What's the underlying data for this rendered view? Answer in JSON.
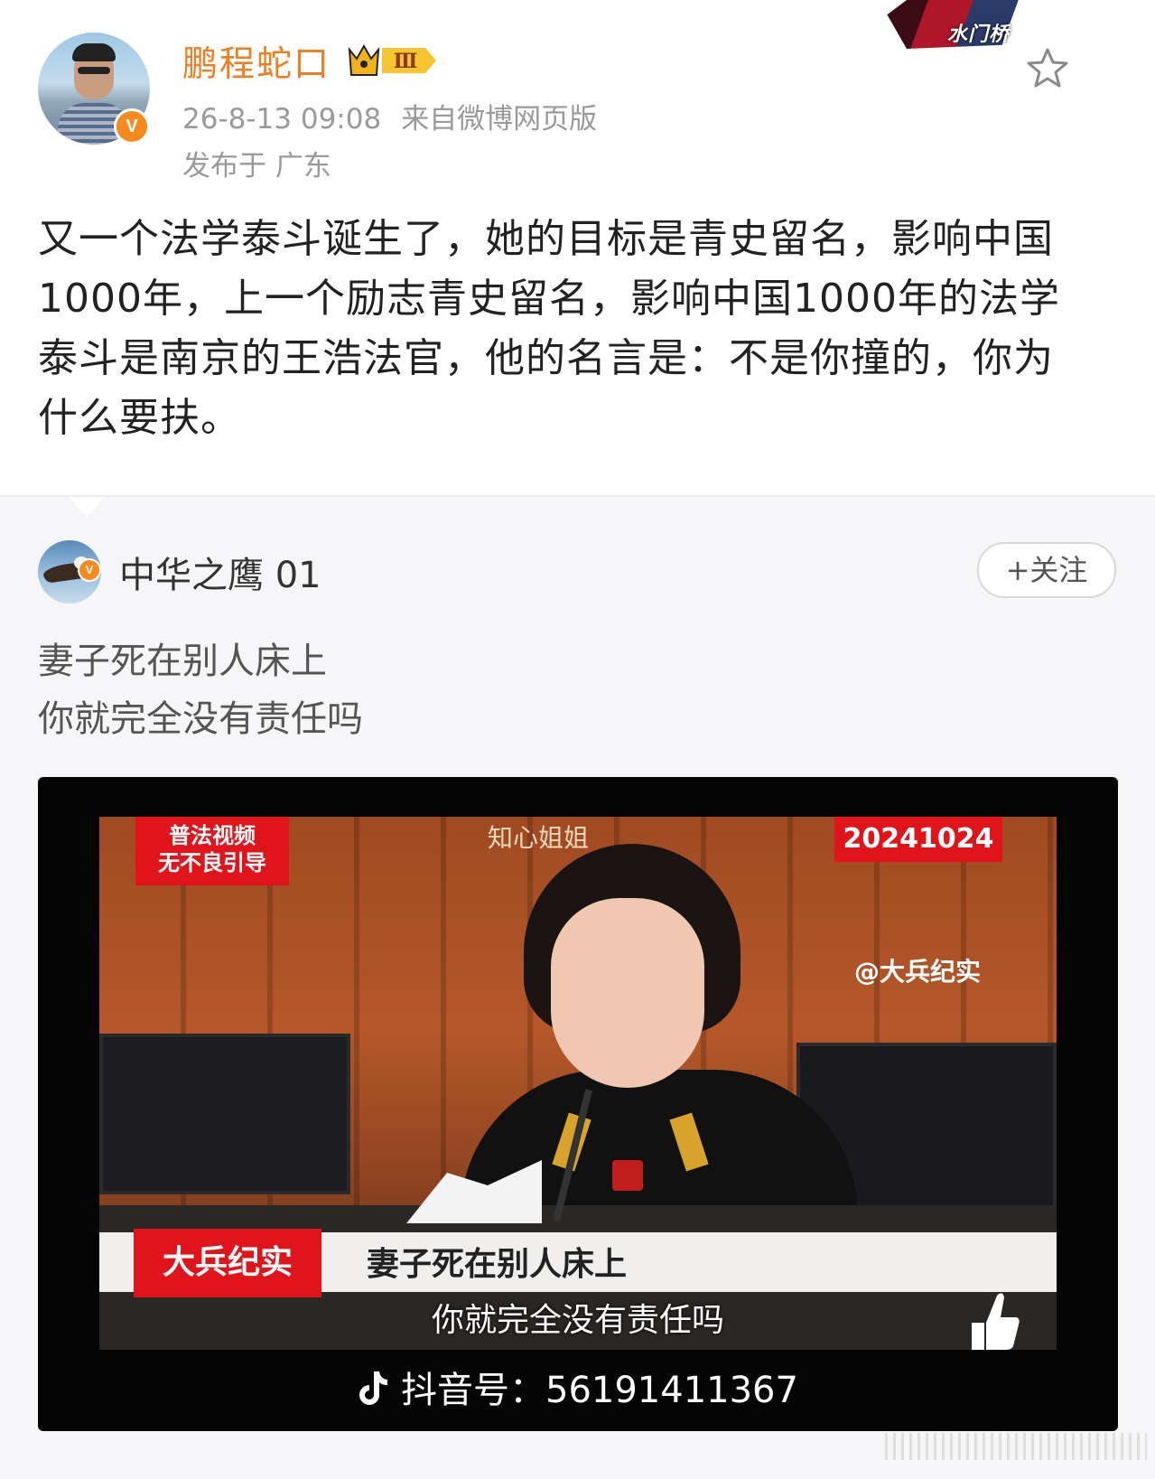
{
  "post": {
    "username": "鹏程蛇口",
    "badge_level": "Ⅲ",
    "verified_mark": "V",
    "timestamp": "26-8-13 09:08",
    "source": "来自微博网页版",
    "location": "发布于 广东",
    "text": "又一个法学泰斗诞生了，她的目标是青史留名，影响中国1000年，上一个励志青史留名，影响中国1000年的法学泰斗是南京的王浩法官，他的名言是：不是你撞的，你为什么要扶。",
    "favorite_icon": "star-icon",
    "corner_logo_text": "水门桥"
  },
  "repost": {
    "username": "中华之鹰 01",
    "verified_mark": "V",
    "follow_label": "+关注",
    "text_line1": "妻子死在别人床上",
    "text_line2": "你就完全没有责任吗"
  },
  "video": {
    "top_left_tag_line1": "普法视频",
    "top_left_tag_line2": "无不良引导",
    "top_center_watermark": "知心姐姐",
    "date_badge": "20241024",
    "handle_watermark": "@大兵纪实",
    "brand_tag": "大兵纪实",
    "subtitle_line1": "妻子死在别人床上",
    "subtitle_line2": "你就完全没有责任吗",
    "tiktok_id": "抖音号：56191411367",
    "colors": {
      "tag_red": "#e0141b",
      "accent_orange": "#f07d20"
    }
  }
}
